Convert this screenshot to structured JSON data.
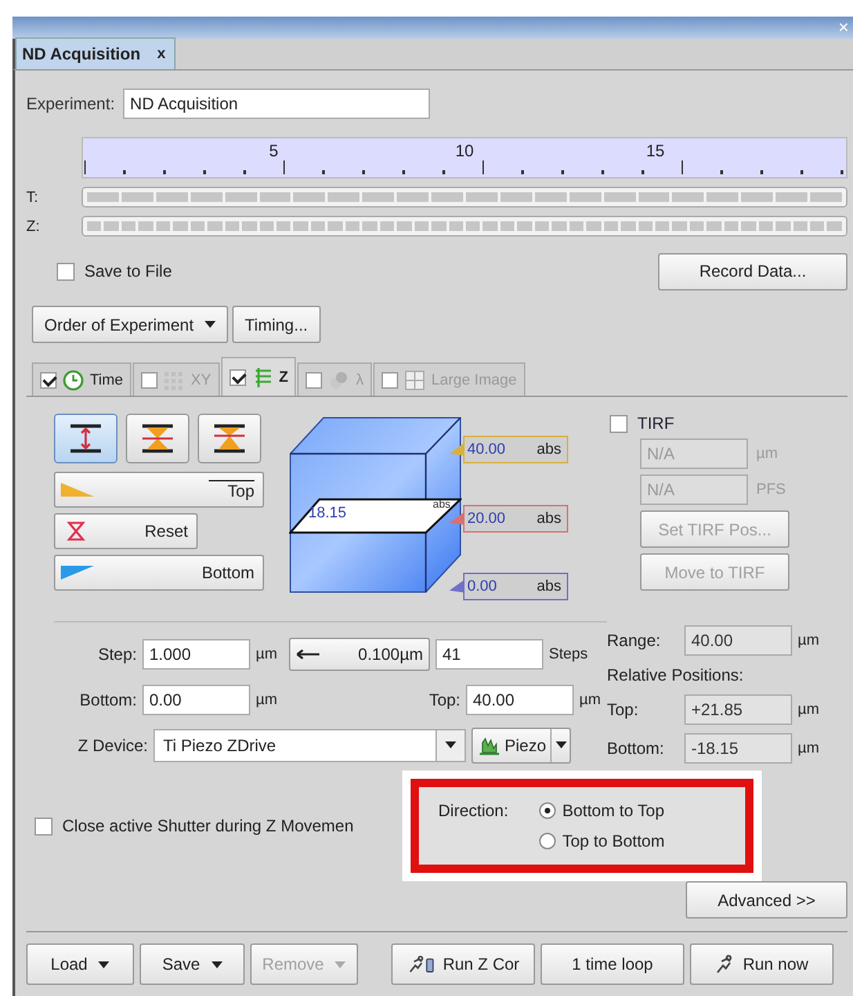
{
  "title_bar": {
    "close": "×"
  },
  "tab": {
    "label": "ND Acquisition",
    "close": "x"
  },
  "experiment": {
    "label": "Experiment:",
    "value": "ND Acquisition"
  },
  "timeline": {
    "ticks": [
      "5",
      "10",
      "15"
    ],
    "rows": [
      {
        "label": "T:",
        "kind": "long"
      },
      {
        "label": "Z:",
        "kind": "short"
      }
    ]
  },
  "save_to_file": {
    "label": "Save to File",
    "checked": false
  },
  "record_button": "Record Data...",
  "order_button": "Order of Experiment",
  "timing_button": "Timing...",
  "dimension_tabs": [
    {
      "kind": "time",
      "label": "Time",
      "checked": true,
      "selected": false,
      "disabled": false
    },
    {
      "kind": "xy",
      "label": "XY",
      "checked": false,
      "selected": false,
      "disabled": true
    },
    {
      "kind": "z",
      "label": "Z",
      "checked": true,
      "selected": true,
      "disabled": false
    },
    {
      "kind": "lambda",
      "label": "λ",
      "checked": false,
      "selected": false,
      "disabled": true
    },
    {
      "kind": "large_image",
      "label": "Large Image",
      "checked": false,
      "selected": false,
      "disabled": true
    }
  ],
  "z_modes": [
    {
      "kind": "range",
      "selected": true
    },
    {
      "kind": "symmetric",
      "selected": false
    },
    {
      "kind": "asymmetric",
      "selected": false
    }
  ],
  "position_buttons": [
    {
      "kind": "top",
      "label": "Top"
    },
    {
      "kind": "reset",
      "label": "Reset"
    },
    {
      "kind": "bottom",
      "label": "Bottom"
    }
  ],
  "stack": {
    "home": "18.15",
    "home_unit": "abs",
    "markers": [
      {
        "value": "40.00",
        "unit": "abs",
        "color": "#d8b040"
      },
      {
        "value": "20.00",
        "unit": "abs",
        "color": "#d87070"
      },
      {
        "value": "0.00",
        "unit": "abs",
        "color": "#7070c8"
      }
    ]
  },
  "tirf": {
    "label": "TIRF",
    "checked": false,
    "fields": [
      {
        "value": "N/A",
        "unit": "µm"
      },
      {
        "value": "N/A",
        "unit": "PFS"
      }
    ],
    "buttons": [
      "Set TIRF Pos...",
      "Move to TIRF"
    ]
  },
  "step": {
    "label": "Step:",
    "value": "1.000",
    "unit": "µm",
    "increment": "0.100µm",
    "steps_value": "41",
    "steps_label": "Steps"
  },
  "bottom": {
    "label": "Bottom:",
    "value": "0.00",
    "unit": "µm"
  },
  "top": {
    "label": "Top:",
    "value": "40.00",
    "unit": "µm"
  },
  "z_device": {
    "label": "Z Device:",
    "value": "Ti Piezo ZDrive",
    "mode": "Piezo"
  },
  "range": {
    "label": "Range:",
    "value": "40.00",
    "unit": "µm"
  },
  "relative": {
    "title": "Relative Positions:",
    "rows": [
      {
        "label": "Top:",
        "value": "+21.85",
        "unit": "µm"
      },
      {
        "label": "Bottom:",
        "value": "-18.15",
        "unit": "µm"
      }
    ]
  },
  "close_shutter": {
    "label": "Close active Shutter during Z Movemen",
    "checked": false
  },
  "direction": {
    "label": "Direction:",
    "highlighted": true,
    "options": [
      {
        "label": "Bottom to Top",
        "selected": true
      },
      {
        "label": "Top to Bottom",
        "selected": false
      }
    ]
  },
  "advanced_button": "Advanced >>",
  "footer_buttons": [
    {
      "kind": "plain",
      "label": "Load",
      "dropdown": true,
      "disabled": false
    },
    {
      "kind": "plain",
      "label": "Save",
      "dropdown": true,
      "disabled": false
    },
    {
      "kind": "plain",
      "label": "Remove",
      "dropdown": true,
      "disabled": true
    },
    {
      "kind": "run_z",
      "label": "Run Z Cor",
      "dropdown": false,
      "disabled": false
    },
    {
      "kind": "plain",
      "label": "1 time loop",
      "dropdown": false,
      "disabled": false
    },
    {
      "kind": "run",
      "label": "Run now",
      "dropdown": false,
      "disabled": false
    }
  ]
}
